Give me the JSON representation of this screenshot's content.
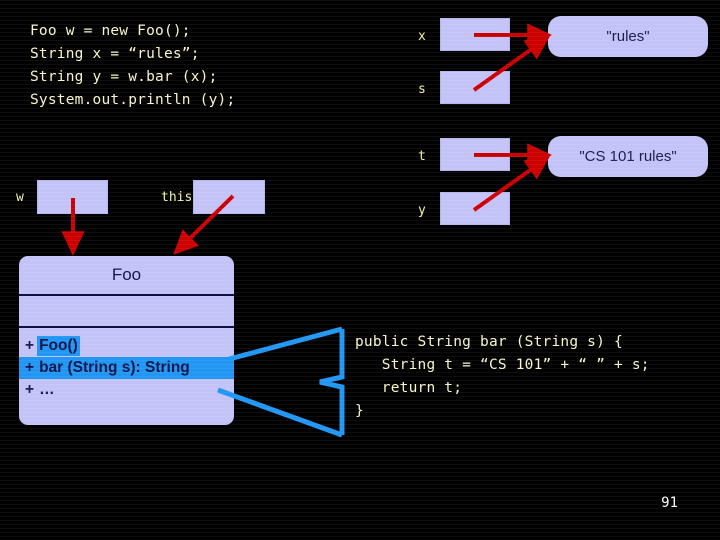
{
  "slide": {
    "page_number": "91",
    "background_color": "#000000"
  },
  "code_main": {
    "lines": [
      "Foo w = new Foo();",
      "String x = “rules”;",
      "String y = w.bar (x);",
      "System.out.println (y);"
    ],
    "text_color": "#f6f6c8"
  },
  "code_method": {
    "lines": [
      "public String bar (String s) {",
      "   String t = “CS 101” + “ ” + s;",
      "   return t;",
      "}"
    ],
    "text_color": "#f6f6c8"
  },
  "variables": [
    {
      "name": "x",
      "label": "x",
      "value_ref": "rules"
    },
    {
      "name": "s",
      "label": "s",
      "value_ref": "rules"
    },
    {
      "name": "t",
      "label": "t",
      "value_ref": "cs101rules"
    },
    {
      "name": "y",
      "label": "y",
      "value_ref": "cs101rules"
    },
    {
      "name": "w",
      "label": "w",
      "value_ref": "foo-object"
    },
    {
      "name": "this",
      "label": "this",
      "value_ref": "foo-object"
    }
  ],
  "values": [
    {
      "id": "rules",
      "text": "\"rules\""
    },
    {
      "id": "cs101rules",
      "text": "\"CS 101 rules\""
    }
  ],
  "class_box": {
    "name": "Foo",
    "attributes": [],
    "methods": [
      {
        "visibility": "+",
        "signature": "Foo()",
        "highlight": "partial"
      },
      {
        "visibility": "+",
        "signature": "bar (String s): String",
        "highlight": "full"
      },
      {
        "visibility": "+",
        "signature": "…",
        "highlight": "none"
      }
    ]
  },
  "colors": {
    "box_fill": "#c3c3f7",
    "box_text": "#15154a",
    "code_text": "#f6f6c8",
    "var_label": "#f2f2a8",
    "arrow_red": "#cc0000",
    "connector_blue": "#2196f3",
    "highlight_blue": "#2196f3",
    "page_number": "#ffffff"
  }
}
